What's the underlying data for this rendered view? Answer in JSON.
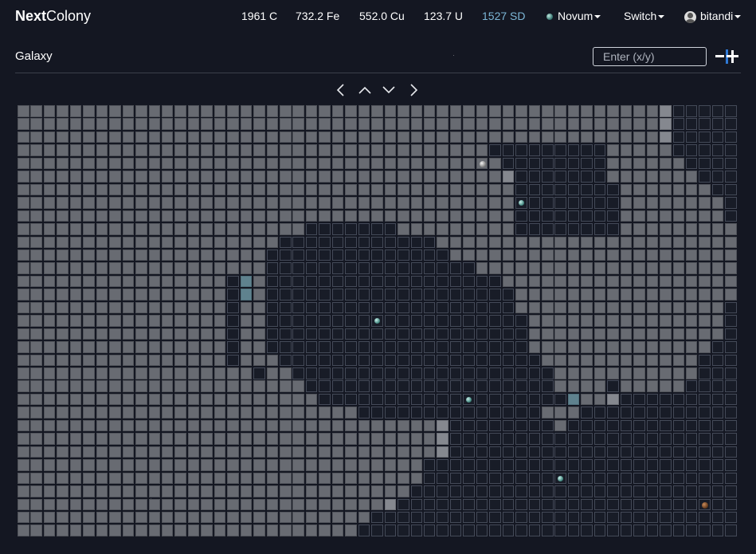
{
  "header": {
    "brand_bold": "Next",
    "brand_rest": "Colony",
    "resources": {
      "coal": "1961 C",
      "iron": "732.2 Fe",
      "copper": "552.0 Cu",
      "uranium": "123.7 U",
      "sd": "1527 SD"
    },
    "planet_menu": "Novum",
    "switch_menu": "Switch",
    "user_menu": "bitandi"
  },
  "galaxy": {
    "title": "Galaxy",
    "search_placeholder": "Enter (x/y)",
    "navigation": [
      "chevron-left-icon",
      "chevron-up-icon",
      "chevron-down-icon",
      "chevron-right-icon"
    ]
  },
  "colors": {
    "sd_accent": "#7cb6d6",
    "explored_tile": "#686b72",
    "unexplored_tile": "#181c27",
    "highlight_tile": "#5f828e",
    "zoom_accent": "#2f79d6"
  }
}
